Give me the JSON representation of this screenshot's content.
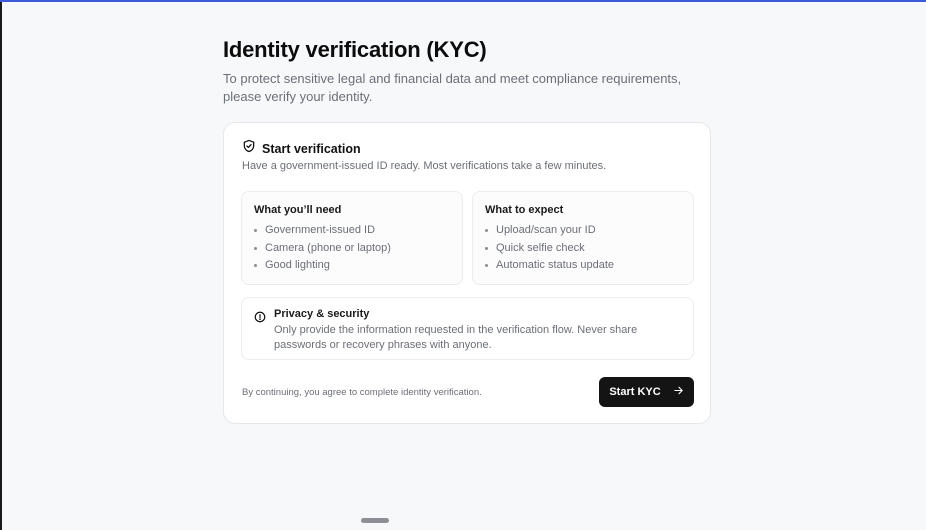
{
  "header": {
    "title": "Identity verification (KYC)",
    "subtitle": "To protect sensitive legal and financial data and meet compliance requirements, please verify your identity."
  },
  "card": {
    "title": "Start verification",
    "title_icon": "shield-check-icon",
    "description": "Have a government-issued ID ready. Most verifications take a few minutes.",
    "need": {
      "title": "What you’ll need",
      "items": [
        "Government-issued ID",
        "Camera (phone or laptop)",
        "Good lighting"
      ]
    },
    "expect": {
      "title": "What to expect",
      "items": [
        "Upload/scan your ID",
        "Quick selfie check",
        "Automatic status update"
      ]
    },
    "privacy": {
      "icon": "info-circle-icon",
      "title": "Privacy & security",
      "text": "Only provide the information requested in the verification flow. Never share passwords or recovery phrases with anyone."
    },
    "footer_note": "By continuing, you agree to complete identity verification.",
    "start_button": "Start KYC",
    "start_button_icon": "arrow-right-icon"
  },
  "colors": {
    "accent_bar": "#3b5bdb",
    "button_bg": "#141414",
    "background": "#f7f8fa"
  }
}
